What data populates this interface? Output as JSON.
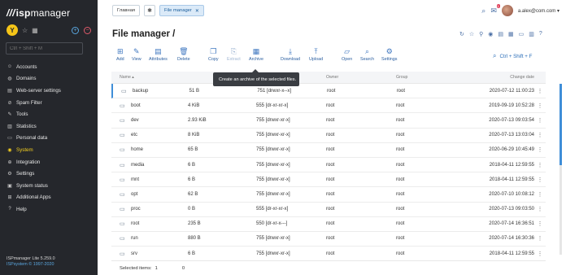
{
  "sidebar": {
    "logo_slashes": "///",
    "logo_isp": "isp",
    "logo_manager": "manager",
    "avatar_letter": "Y",
    "search_placeholder": "Ctrl + Shift + M",
    "items": [
      {
        "label": "Accounts",
        "icon": "user-icon"
      },
      {
        "label": "Domains",
        "icon": "globe-icon"
      },
      {
        "label": "Web-server settings",
        "icon": "server-icon"
      },
      {
        "label": "Spam Filter",
        "icon": "filter-icon"
      },
      {
        "label": "Tools",
        "icon": "wrench-icon"
      },
      {
        "label": "Statistics",
        "icon": "chart-icon"
      },
      {
        "label": "Personal data",
        "icon": "id-card-icon"
      },
      {
        "label": "System",
        "icon": "system-icon",
        "active": true
      },
      {
        "label": "Integration",
        "icon": "integration-icon"
      },
      {
        "label": "Settings",
        "icon": "gear-icon"
      },
      {
        "label": "System status",
        "icon": "monitor-icon"
      },
      {
        "label": "Additional Apps",
        "icon": "apps-icon"
      },
      {
        "label": "Help",
        "icon": "help-icon"
      }
    ],
    "version": "ISPmanager Lite 5.259.0",
    "copyright": "ISPsystem © 1997-2020"
  },
  "topbar": {
    "home_tab": "Главная",
    "active_tab": "File manager",
    "notification_count": "1",
    "user": "a.alex@com.com"
  },
  "page": {
    "title": "File manager /"
  },
  "toolbar": {
    "items": [
      {
        "label": "Add",
        "icon": "add-icon"
      },
      {
        "label": "View",
        "icon": "edit-icon"
      },
      {
        "label": "Attributes",
        "icon": "attributes-icon"
      },
      {
        "label": "Delete",
        "icon": "delete-icon"
      },
      {
        "label": "Copy",
        "icon": "copy-icon"
      },
      {
        "label": "Extract",
        "icon": "extract-icon",
        "disabled": true
      },
      {
        "label": "Archive",
        "icon": "archive-icon"
      },
      {
        "label": "Download",
        "icon": "download-icon"
      },
      {
        "label": "Upload",
        "icon": "upload-icon"
      },
      {
        "label": "Open",
        "icon": "folder-open-icon"
      },
      {
        "label": "Search",
        "icon": "search-icon"
      },
      {
        "label": "Settings",
        "icon": "gear-icon"
      }
    ],
    "quick_search": "Ctrl + Shift + F",
    "tooltip": "Create an archive of the selected files."
  },
  "table": {
    "headers": {
      "name": "Name",
      "size": "",
      "perm": "",
      "owner": "Owner",
      "group": "Group",
      "date": "Change date"
    },
    "rows": [
      {
        "name": "backup",
        "size": "51 B",
        "perm": "751 [drwxr-x--x]",
        "owner": "root",
        "group": "root",
        "date": "2020-07-12 11:00:23"
      },
      {
        "name": "boot",
        "size": "4 KiB",
        "perm": "555 [dr-xr-xr-x]",
        "owner": "root",
        "group": "root",
        "date": "2019-09-19 10:52:28"
      },
      {
        "name": "dev",
        "size": "2.93 KiB",
        "perm": "755 [drwxr-xr-x]",
        "owner": "root",
        "group": "root",
        "date": "2020-07-13 09:03:54"
      },
      {
        "name": "etc",
        "size": "8 KiB",
        "perm": "755 [drwxr-xr-x]",
        "owner": "root",
        "group": "root",
        "date": "2020-07-13 13:03:04"
      },
      {
        "name": "home",
        "size": "65 B",
        "perm": "755 [drwxr-xr-x]",
        "owner": "root",
        "group": "root",
        "date": "2020-06-29 10:45:49"
      },
      {
        "name": "media",
        "size": "6 B",
        "perm": "755 [drwxr-xr-x]",
        "owner": "root",
        "group": "root",
        "date": "2018-04-11 12:59:55"
      },
      {
        "name": "mnt",
        "size": "6 B",
        "perm": "755 [drwxr-xr-x]",
        "owner": "root",
        "group": "root",
        "date": "2018-04-11 12:59:55"
      },
      {
        "name": "opt",
        "size": "62 B",
        "perm": "755 [drwxr-xr-x]",
        "owner": "root",
        "group": "root",
        "date": "2020-07-10 10:08:12"
      },
      {
        "name": "proc",
        "size": "0 B",
        "perm": "555 [dr-xr-xr-x]",
        "owner": "root",
        "group": "root",
        "date": "2020-07-13 09:03:50"
      },
      {
        "name": "root",
        "size": "235 B",
        "perm": "550 [dr-xr-x---]",
        "owner": "root",
        "group": "root",
        "date": "2020-07-14 16:36:51"
      },
      {
        "name": "run",
        "size": "880 B",
        "perm": "755 [drwxr-xr-x]",
        "owner": "root",
        "group": "root",
        "date": "2020-07-14 16:30:36"
      },
      {
        "name": "srv",
        "size": "6 B",
        "perm": "755 [drwxr-xr-x]",
        "owner": "root",
        "group": "root",
        "date": "2018-04-11 12:59:55"
      }
    ]
  },
  "footer": {
    "selected_label": "Selected items:",
    "selected_count": "1",
    "other_count": "0"
  }
}
